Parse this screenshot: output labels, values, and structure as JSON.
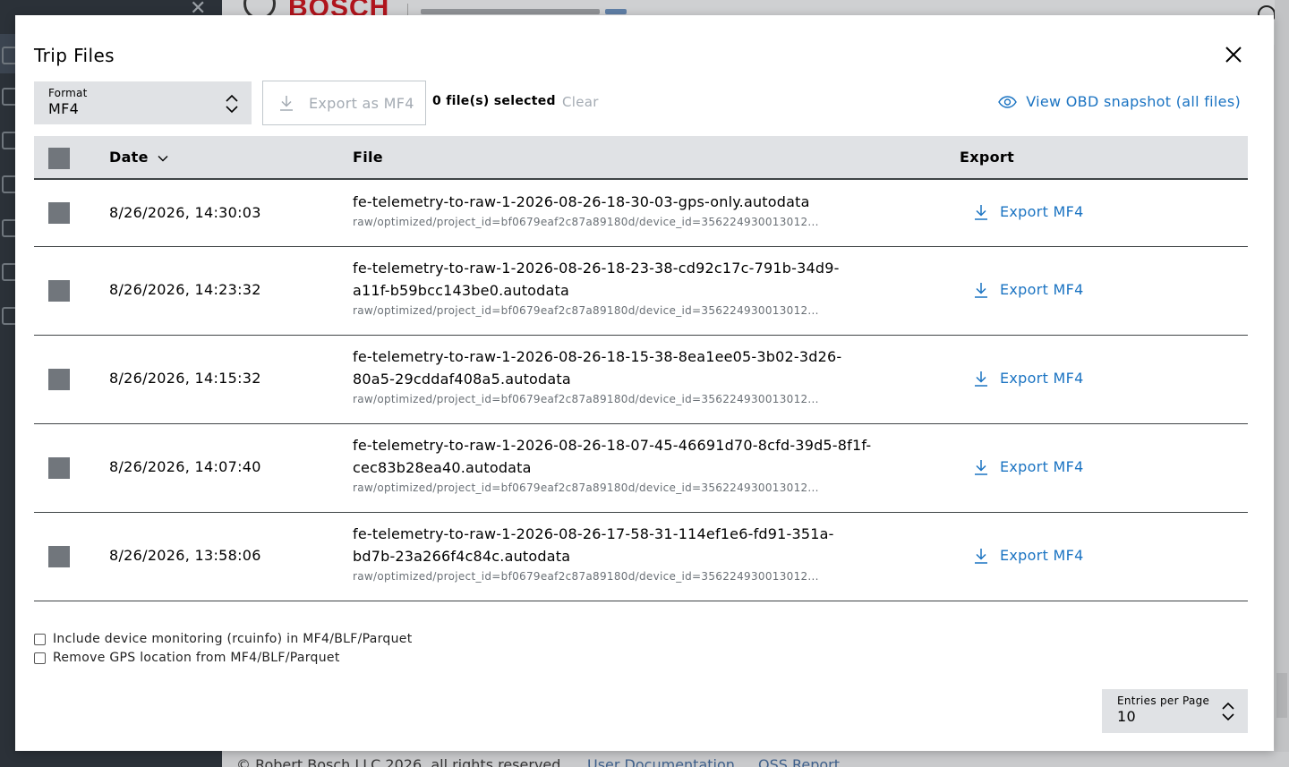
{
  "background": {
    "brand": "BOSCH",
    "footer_copyright": "© Robert Bosch LLC 2026, all rights reserved",
    "footer_link_docs": "User Documentation",
    "footer_link_oss": "OSS Report"
  },
  "modal": {
    "title": "Trip Files",
    "format": {
      "label": "Format",
      "value": "MF4"
    },
    "export_button_label": "Export as MF4",
    "selected_count": "0 file(s) selected",
    "clear_label": "Clear",
    "obd_link_label": "View OBD snapshot (all files)",
    "table": {
      "headers": {
        "date": "Date",
        "file": "File",
        "export": "Export"
      },
      "sort": "date-desc",
      "rows": [
        {
          "date": "8/26/2026, 14:30:03",
          "file": "fe-telemetry-to-raw-1-2026-08-26-18-30-03-gps-only.autodata",
          "path": "raw/optimized/project_id=bf0679eaf2c87a89180d/device_id=356224930013012...",
          "export_label": "Export MF4"
        },
        {
          "date": "8/26/2026, 14:23:32",
          "file": "fe-telemetry-to-raw-1-2026-08-26-18-23-38-cd92c17c-791b-34d9-a11f-b59bcc143be0.autodata",
          "path": "raw/optimized/project_id=bf0679eaf2c87a89180d/device_id=356224930013012...",
          "export_label": "Export MF4"
        },
        {
          "date": "8/26/2026, 14:15:32",
          "file": "fe-telemetry-to-raw-1-2026-08-26-18-15-38-8ea1ee05-3b02-3d26-80a5-29cddaf408a5.autodata",
          "path": "raw/optimized/project_id=bf0679eaf2c87a89180d/device_id=356224930013012...",
          "export_label": "Export MF4"
        },
        {
          "date": "8/26/2026, 14:07:40",
          "file": "fe-telemetry-to-raw-1-2026-08-26-18-07-45-46691d70-8cfd-39d5-8f1f-cec83b28ea40.autodata",
          "path": "raw/optimized/project_id=bf0679eaf2c87a89180d/device_id=356224930013012...",
          "export_label": "Export MF4"
        },
        {
          "date": "8/26/2026, 13:58:06",
          "file": "fe-telemetry-to-raw-1-2026-08-26-17-58-31-114ef1e6-fd91-351a-bd7b-23a266f4c84c.autodata",
          "path": "raw/optimized/project_id=bf0679eaf2c87a89180d/device_id=356224930013012...",
          "export_label": "Export MF4"
        }
      ]
    },
    "options": {
      "include_monitoring": "Include device monitoring (rcuinfo) in MF4/BLF/Parquet",
      "remove_gps": "Remove GPS location from MF4/BLF/Parquet"
    },
    "entries_per_page": {
      "label": "Entries per Page",
      "value": "10"
    }
  },
  "colors": {
    "accent": "#1a73c2",
    "checkbox": "#71767c",
    "select_bg": "#e0e2e5",
    "disabled_text": "#a4abb3",
    "overlay": "#7a7d80"
  },
  "icons": [
    "close-icon",
    "chevron-up-down-icon",
    "download-icon",
    "eye-icon",
    "chevron-down-icon"
  ]
}
